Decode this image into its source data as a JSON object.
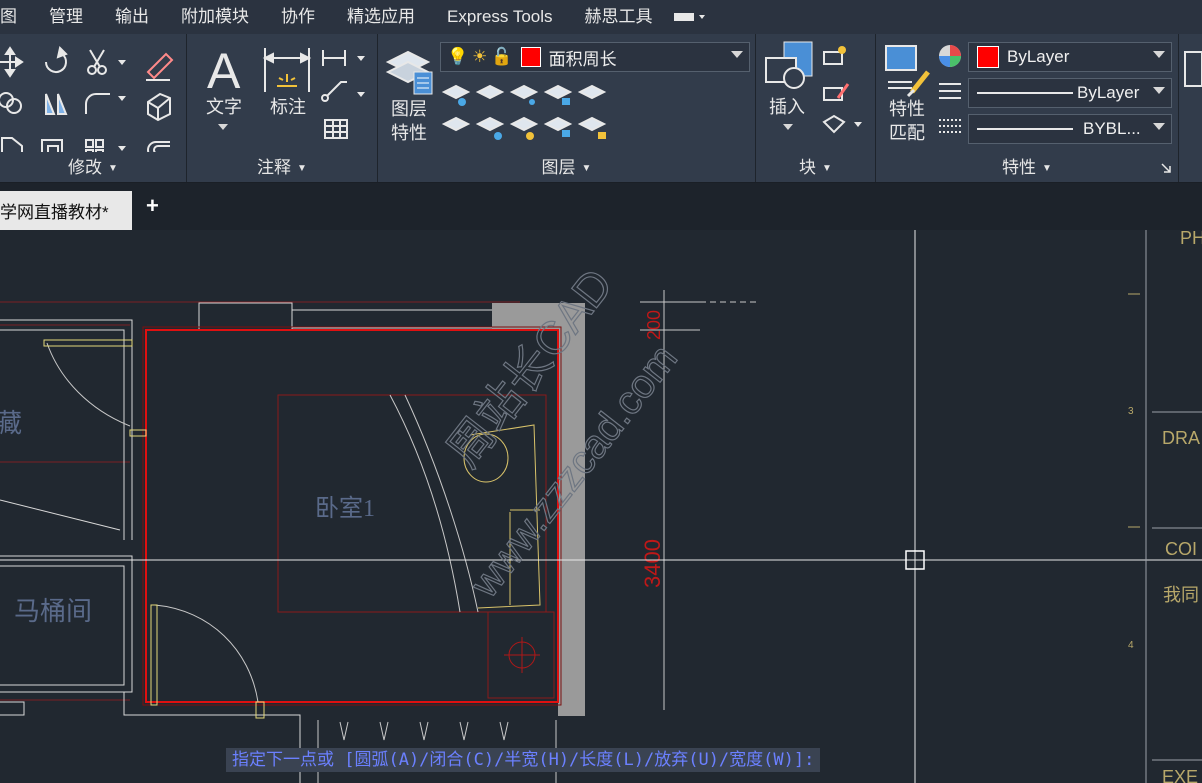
{
  "menubar": {
    "items": [
      "图",
      "管理",
      "输出",
      "附加模块",
      "协作",
      "精选应用",
      "Express Tools",
      "赫思工具"
    ]
  },
  "ribbon": {
    "modify": {
      "title": "修改"
    },
    "annotation": {
      "title": "注释",
      "text_label": "文字",
      "dim_label": "标注"
    },
    "layers": {
      "title": "图层",
      "layer_props_label_1": "图层",
      "layer_props_label_2": "特性",
      "current_layer": "面积周长",
      "current_layer_color": "#ff0000"
    },
    "block": {
      "title": "块",
      "insert_label": "插入"
    },
    "properties": {
      "title": "特性",
      "match_label_1": "特性",
      "match_label_2": "匹配",
      "color_value": "ByLayer",
      "linetype_value": "ByLayer",
      "lineweight_value": "BYBL..."
    }
  },
  "tabs": {
    "document": "学网直播教材*",
    "new_tab": "+"
  },
  "drawing": {
    "room_label_1": "卧室1",
    "room_label_2": "马桶间",
    "room_label_3": "藏",
    "dim_top": "200",
    "dim_side": "3400",
    "watermark_1": "周站长CAD",
    "watermark_2": "www.zzzcad.com",
    "title_block_1": "PH",
    "title_block_2": "DRA",
    "title_block_3": "COI",
    "title_block_4": "我同",
    "title_block_5": "EXE",
    "tick_3": "3",
    "tick_4": "4"
  },
  "command": {
    "prompt": "指定下一点或 [圆弧(A)/闭合(C)/半宽(H)/长度(L)/放弃(U)/宽度(W)]:"
  },
  "colors": {
    "accent_red": "#ff0000",
    "accent_yellow": "#e4d87a",
    "menubar_bg": "#2b3340",
    "ribbon_bg": "#323c4b",
    "canvas_bg": "#212830"
  }
}
